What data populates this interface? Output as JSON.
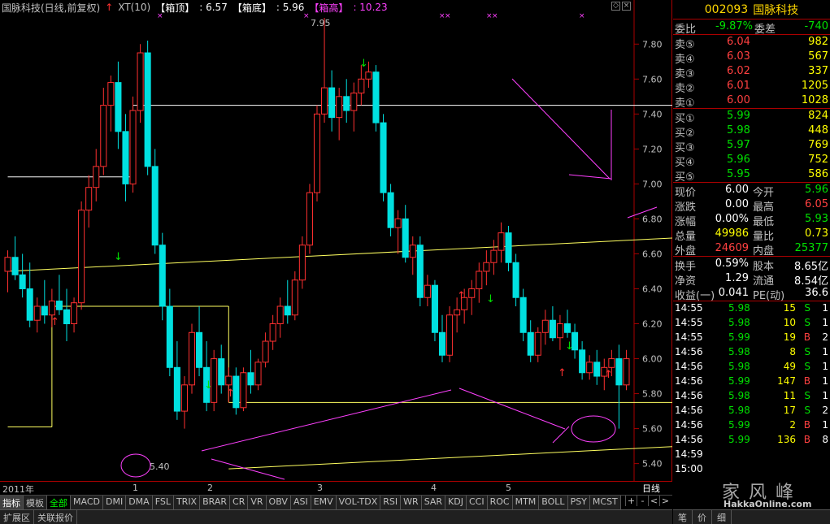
{
  "header": {
    "stock_name": "国脉科技(日线,前复权)",
    "indicator": "XT(10)",
    "box_top_label": "【箱顶】",
    "box_top_value": ": 6.57",
    "box_bottom_label": "【箱底】",
    "box_bottom_value": ": 5.96",
    "box_high_label": "【箱高】",
    "box_high_value": ": 10.23"
  },
  "window_controls": [
    "◇",
    "×"
  ],
  "colors": {
    "up": "#ff3030",
    "down": "#00e0e0",
    "box": "#ffffff",
    "trend": "#ffff60",
    "annot": "#ff40ff"
  },
  "chart_data": {
    "type": "candlestick",
    "y_ticks": [
      "7.80",
      "7.60",
      "7.40",
      "7.20",
      "7.00",
      "6.80",
      "6.60",
      "6.40",
      "6.20",
      "6.00",
      "5.80",
      "5.60",
      "5.40"
    ],
    "ylim": [
      5.31,
      7.95
    ],
    "high_label": "7.95",
    "low_label": "5.40",
    "x_labels": [
      "2011年",
      "1",
      "2",
      "3",
      "4",
      "5"
    ],
    "period": "日线",
    "candles": [
      [
        6.5,
        6.62,
        6.38,
        6.58
      ],
      [
        6.58,
        6.7,
        6.45,
        6.48
      ],
      [
        6.48,
        6.6,
        6.35,
        6.4
      ],
      [
        6.4,
        6.55,
        6.18,
        6.22
      ],
      [
        6.22,
        6.35,
        6.15,
        6.3
      ],
      [
        6.3,
        6.45,
        6.2,
        6.25
      ],
      [
        6.25,
        6.4,
        6.18,
        6.33
      ],
      [
        6.33,
        6.48,
        6.25,
        6.28
      ],
      [
        6.28,
        6.4,
        6.1,
        6.2
      ],
      [
        6.2,
        6.35,
        6.15,
        6.32
      ],
      [
        6.32,
        6.9,
        6.28,
        6.85
      ],
      [
        6.85,
        7.05,
        6.75,
        6.98
      ],
      [
        6.98,
        7.2,
        6.9,
        7.1
      ],
      [
        7.1,
        7.55,
        7.05,
        7.45
      ],
      [
        7.45,
        7.62,
        7.3,
        7.58
      ],
      [
        7.58,
        7.7,
        7.2,
        7.3
      ],
      [
        7.3,
        7.4,
        6.9,
        7.0
      ],
      [
        7.0,
        7.5,
        6.95,
        7.42
      ],
      [
        7.42,
        7.8,
        7.35,
        7.75
      ],
      [
        7.75,
        7.82,
        7.05,
        7.1
      ],
      [
        7.1,
        7.2,
        6.6,
        6.65
      ],
      [
        6.65,
        6.72,
        6.22,
        6.3
      ],
      [
        6.3,
        6.4,
        5.9,
        5.95
      ],
      [
        5.95,
        6.1,
        5.65,
        5.7
      ],
      [
        5.7,
        5.9,
        5.6,
        5.85
      ],
      [
        5.85,
        6.2,
        5.8,
        6.15
      ],
      [
        6.15,
        6.3,
        5.9,
        5.95
      ],
      [
        5.95,
        6.1,
        5.7,
        5.75
      ],
      [
        5.75,
        6.05,
        5.7,
        6.0
      ],
      [
        6.0,
        6.08,
        5.8,
        5.85
      ],
      [
        5.85,
        5.95,
        5.75,
        5.9
      ],
      [
        5.9,
        5.95,
        5.68,
        5.72
      ],
      [
        5.72,
        5.95,
        5.7,
        5.92
      ],
      [
        5.92,
        6.05,
        5.8,
        5.85
      ],
      [
        5.85,
        6.0,
        5.82,
        5.98
      ],
      [
        5.98,
        6.15,
        5.95,
        6.1
      ],
      [
        6.1,
        6.25,
        6.05,
        6.2
      ],
      [
        6.2,
        6.35,
        6.12,
        6.3
      ],
      [
        6.3,
        6.45,
        6.2,
        6.25
      ],
      [
        6.25,
        6.5,
        6.22,
        6.45
      ],
      [
        6.45,
        6.7,
        6.4,
        6.65
      ],
      [
        6.65,
        7.0,
        6.6,
        6.95
      ],
      [
        6.95,
        7.45,
        6.9,
        7.4
      ],
      [
        7.4,
        7.95,
        7.35,
        7.55
      ],
      [
        7.55,
        7.65,
        7.3,
        7.38
      ],
      [
        7.38,
        7.55,
        7.25,
        7.5
      ],
      [
        7.5,
        7.6,
        7.35,
        7.42
      ],
      [
        7.42,
        7.58,
        7.3,
        7.52
      ],
      [
        7.52,
        7.68,
        7.45,
        7.6
      ],
      [
        7.6,
        7.7,
        7.55,
        7.64
      ],
      [
        7.64,
        7.68,
        7.3,
        7.35
      ],
      [
        7.35,
        7.4,
        6.9,
        6.95
      ],
      [
        6.95,
        7.0,
        6.7,
        6.75
      ],
      [
        6.75,
        6.85,
        6.6,
        6.8
      ],
      [
        6.8,
        6.88,
        6.55,
        6.58
      ],
      [
        6.58,
        6.7,
        6.48,
        6.65
      ],
      [
        6.65,
        6.7,
        6.3,
        6.35
      ],
      [
        6.35,
        6.48,
        6.3,
        6.42
      ],
      [
        6.42,
        6.45,
        6.1,
        6.15
      ],
      [
        6.15,
        6.25,
        5.98,
        6.02
      ],
      [
        6.02,
        6.3,
        5.98,
        6.25
      ],
      [
        6.25,
        6.35,
        6.15,
        6.28
      ],
      [
        6.28,
        6.4,
        6.2,
        6.35
      ],
      [
        6.35,
        6.45,
        6.25,
        6.4
      ],
      [
        6.4,
        6.55,
        6.32,
        6.5
      ],
      [
        6.5,
        6.62,
        6.42,
        6.55
      ],
      [
        6.55,
        6.68,
        6.48,
        6.62
      ],
      [
        6.62,
        6.78,
        6.55,
        6.72
      ],
      [
        6.72,
        6.76,
        6.5,
        6.55
      ],
      [
        6.55,
        6.6,
        6.3,
        6.35
      ],
      [
        6.35,
        6.4,
        6.1,
        6.15
      ],
      [
        6.15,
        6.22,
        5.98,
        6.02
      ],
      [
        6.02,
        6.18,
        5.98,
        6.15
      ],
      [
        6.15,
        6.28,
        6.08,
        6.22
      ],
      [
        6.22,
        6.3,
        6.1,
        6.12
      ],
      [
        6.12,
        6.25,
        6.05,
        6.2
      ],
      [
        6.2,
        6.28,
        6.12,
        6.15
      ],
      [
        6.15,
        6.2,
        6.0,
        6.05
      ],
      [
        6.05,
        6.1,
        5.88,
        5.92
      ],
      [
        5.92,
        6.02,
        5.88,
        5.98
      ],
      [
        5.98,
        6.05,
        5.85,
        5.9
      ],
      [
        5.9,
        6.0,
        5.82,
        5.95
      ],
      [
        5.95,
        6.05,
        5.9,
        6.0
      ],
      [
        6.0,
        6.08,
        5.6,
        5.85
      ],
      [
        5.85,
        6.05,
        5.82,
        6.0
      ]
    ],
    "box_segments": [
      [
        0,
        7.04,
        17,
        7.04
      ],
      [
        17,
        7.45,
        107,
        7.45
      ],
      [
        107,
        6.56,
        138,
        6.56
      ]
    ],
    "support_segments": [
      [
        0,
        5.61,
        6,
        5.61
      ],
      [
        6,
        6.3,
        30,
        6.3
      ],
      [
        30,
        5.75,
        94,
        5.75
      ],
      [
        94,
        6.15,
        133,
        6.15
      ]
    ],
    "trendlines": [
      [
        0,
        6.5,
        148,
        6.81
      ],
      [
        30,
        5.37,
        140,
        5.6
      ]
    ]
  },
  "tabs": [
    "指标",
    "模板",
    "全部",
    "MACD",
    "DMI",
    "DMA",
    "FSL",
    "TRIX",
    "BRAR",
    "CR",
    "VR",
    "OBV",
    "ASI",
    "EMV",
    "VOL-TDX",
    "RSI",
    "WR",
    "SAR",
    "KDJ",
    "CCI",
    "ROC",
    "MTM",
    "BOLL",
    "PSY",
    "MCST"
  ],
  "tab_right": [
    "+",
    "-",
    "<",
    ">"
  ],
  "statusbar": [
    "扩展区",
    "关联报价"
  ],
  "panel": {
    "code": "002093",
    "name": "国脉科技",
    "weibi_label": "委比",
    "weibi_value": "-9.87%",
    "weicha_label": "委差",
    "weicha_value": "-740",
    "sells": [
      {
        "label": "卖⑤",
        "price": "6.04",
        "vol": "982"
      },
      {
        "label": "卖④",
        "price": "6.03",
        "vol": "567"
      },
      {
        "label": "卖③",
        "price": "6.02",
        "vol": "337"
      },
      {
        "label": "卖②",
        "price": "6.01",
        "vol": "1205"
      },
      {
        "label": "卖①",
        "price": "6.00",
        "vol": "1028"
      }
    ],
    "buys": [
      {
        "label": "买①",
        "price": "5.99",
        "vol": "824"
      },
      {
        "label": "买②",
        "price": "5.98",
        "vol": "448"
      },
      {
        "label": "买③",
        "price": "5.97",
        "vol": "769"
      },
      {
        "label": "买④",
        "price": "5.96",
        "vol": "752"
      },
      {
        "label": "买⑤",
        "price": "5.95",
        "vol": "586"
      }
    ],
    "stats": [
      {
        "l1": "现价",
        "v1": "6.00",
        "l2": "今开",
        "v2": "5.96",
        "c1": "wht",
        "c2": "grn"
      },
      {
        "l1": "涨跌",
        "v1": "0.00",
        "l2": "最高",
        "v2": "6.05",
        "c1": "wht",
        "c2": "red"
      },
      {
        "l1": "涨幅",
        "v1": "0.00%",
        "l2": "最低",
        "v2": "5.93",
        "c1": "wht",
        "c2": "grn"
      },
      {
        "l1": "总量",
        "v1": "49986",
        "l2": "量比",
        "v2": "0.73",
        "c1": "yel",
        "c2": "yel"
      },
      {
        "l1": "外盘",
        "v1": "24609",
        "l2": "内盘",
        "v2": "25377",
        "c1": "red",
        "c2": "grn"
      }
    ],
    "finance": [
      {
        "l1": "换手",
        "v1": "0.59%",
        "l2": "股本",
        "v2": "8.65亿"
      },
      {
        "l1": "净资",
        "v1": "1.29",
        "l2": "流通",
        "v2": "8.54亿"
      },
      {
        "l1": "收益(一)",
        "v1": "0.041",
        "l2": "PE(动)",
        "v2": "36.6"
      }
    ],
    "ticks": [
      {
        "t": "14:55",
        "p": "5.98",
        "v": "15",
        "s": "S",
        "n": "1"
      },
      {
        "t": "14:55",
        "p": "5.98",
        "v": "10",
        "s": "S",
        "n": "1"
      },
      {
        "t": "14:55",
        "p": "5.99",
        "v": "19",
        "s": "B",
        "n": "2"
      },
      {
        "t": "14:56",
        "p": "5.98",
        "v": "8",
        "s": "S",
        "n": "1"
      },
      {
        "t": "14:56",
        "p": "5.98",
        "v": "49",
        "s": "S",
        "n": "1"
      },
      {
        "t": "14:56",
        "p": "5.99",
        "v": "147",
        "s": "B",
        "n": "1"
      },
      {
        "t": "14:56",
        "p": "5.98",
        "v": "11",
        "s": "S",
        "n": "1"
      },
      {
        "t": "14:56",
        "p": "5.98",
        "v": "17",
        "s": "S",
        "n": "2"
      },
      {
        "t": "14:56",
        "p": "5.99",
        "v": "2",
        "s": "B",
        "n": "1"
      },
      {
        "t": "14:56",
        "p": "5.99",
        "v": "136",
        "s": "B",
        "n": "8"
      },
      {
        "t": "14:59",
        "p": "",
        "v": "",
        "s": "",
        "n": ""
      },
      {
        "t": "15:00",
        "p": "",
        "v": "",
        "s": "",
        "n": ""
      }
    ],
    "bottom_tabs": [
      "笔",
      "价",
      "细"
    ]
  },
  "watermark": {
    "text": "家 风 峰",
    "url": "HakkaOnline.com"
  }
}
